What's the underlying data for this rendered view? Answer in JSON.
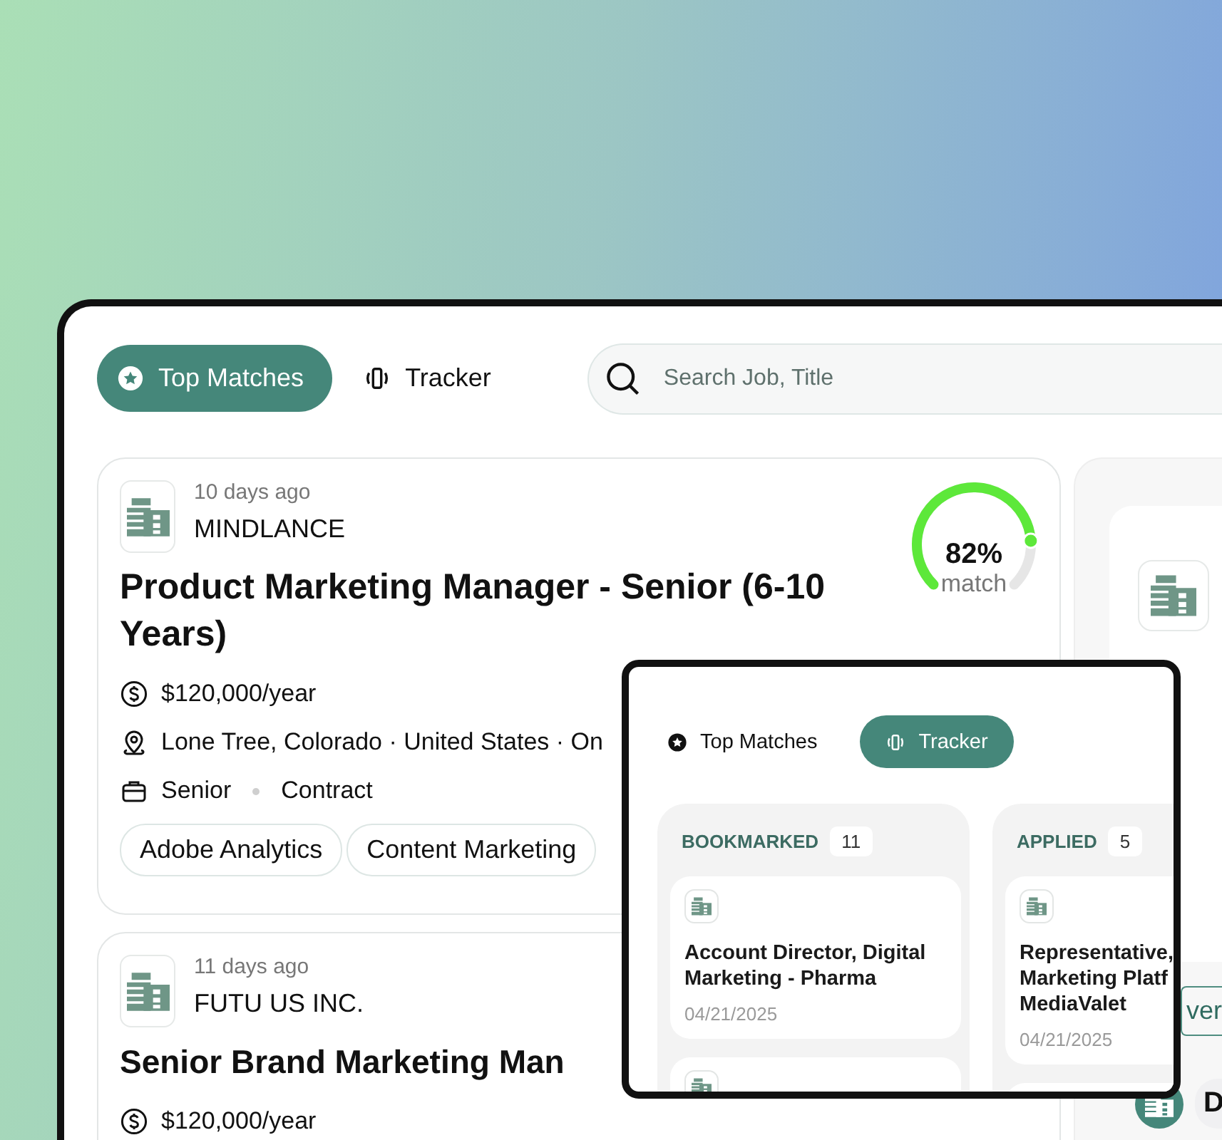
{
  "tabs": [
    {
      "label": "Top Matches",
      "selected": true
    },
    {
      "label": "Tracker",
      "selected": false
    }
  ],
  "search": {
    "placeholder": "Search Job, Title"
  },
  "jobs": [
    {
      "posted": "10 days ago",
      "company": "MINDLANCE",
      "title": "Product Marketing Manager - Senior (6-10 Years)",
      "match": {
        "percent": "82%",
        "label": "match"
      },
      "details": [
        {
          "kind": "salary",
          "parts": [
            "$120,000/year"
          ]
        },
        {
          "kind": "location",
          "parts": [
            "Lone Tree, Colorado · United States · On"
          ]
        },
        {
          "kind": "type",
          "parts": [
            "Senior",
            "Contract"
          ]
        }
      ],
      "skills": [
        "Adobe Analytics",
        "Content Marketing"
      ]
    },
    {
      "posted": "11 days ago",
      "company": "FUTU US INC.",
      "title": "Senior Brand Marketing Man",
      "details": [
        {
          "kind": "salary",
          "parts": [
            "$120,000/year"
          ]
        }
      ]
    }
  ],
  "side_panel": {
    "chip": "ver",
    "row_text": "D"
  },
  "inset": {
    "tabs": [
      {
        "label": "Top Matches",
        "selected": false
      },
      {
        "label": "Tracker",
        "selected": true
      }
    ],
    "columns": [
      {
        "name": "BOOKMARKED",
        "count": "11",
        "cards": [
          {
            "kind": "full",
            "title_lines": [
              "Account Director, Digital",
              "Marketing - Pharma"
            ],
            "date": "04/21/2025"
          },
          {
            "kind": "stub"
          }
        ]
      },
      {
        "name": "APPLIED",
        "count": "5",
        "cards": [
          {
            "kind": "full",
            "title_lines": [
              "Representative,",
              "Marketing Platf",
              "MediaValet"
            ],
            "date": "04/21/2025"
          },
          {
            "kind": "stub"
          }
        ]
      }
    ]
  }
}
